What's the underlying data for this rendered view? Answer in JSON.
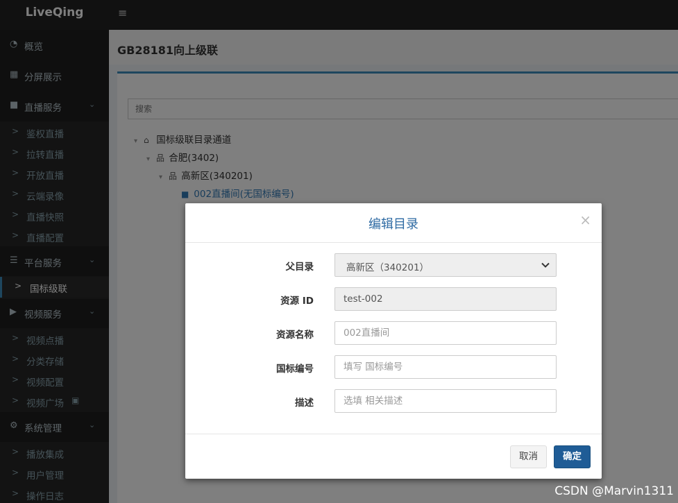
{
  "app": {
    "logo": "LiveQing",
    "menu_icon": "hamburger-icon"
  },
  "sidebar": {
    "items": [
      {
        "icon": "dashboard-icon",
        "glyph": "◔",
        "label": "概览"
      },
      {
        "icon": "grid-icon",
        "glyph": "▦",
        "label": "分屏展示"
      },
      {
        "icon": "video-camera-icon",
        "glyph": "■",
        "label": "直播服务",
        "chevron": "⌄"
      }
    ],
    "live_sub": [
      "鉴权直播",
      "拉转直播",
      "开放直播",
      "云端录像",
      "直播快照",
      "直播配置"
    ],
    "platform": {
      "icon": "server-icon",
      "glyph": "☰",
      "label": "平台服务",
      "chevron": "⌄"
    },
    "platform_sub": [
      "国标级联"
    ],
    "video": {
      "icon": "youtube-icon",
      "glyph": "▶",
      "label": "视频服务",
      "chevron": "⌄"
    },
    "video_sub": [
      "视频点播",
      "分类存储",
      "视频配置",
      "视频广场"
    ],
    "system": {
      "icon": "gear-icon",
      "glyph": "⚙",
      "label": "系统管理",
      "chevron": "⌄"
    },
    "system_sub": [
      "播放集成",
      "用户管理",
      "操作日志"
    ],
    "sub_arrow": ">"
  },
  "page": {
    "title": "GB28181向上级联",
    "search_placeholder": "搜索"
  },
  "tree": [
    {
      "caret": "▾",
      "icon": "home-icon",
      "glyph": "⌂",
      "label": "国标级联目录通道"
    },
    {
      "caret": "▾",
      "icon": "sitemap-icon",
      "glyph": "品",
      "label": "合肥(3402)"
    },
    {
      "caret": "▾",
      "icon": "sitemap-icon",
      "glyph": "品",
      "label": "高新区(340201)"
    },
    {
      "caret": "",
      "icon": "video-camera-icon",
      "glyph": "■",
      "label": "002直播间(无国标编号)"
    }
  ],
  "modal": {
    "title": "编辑目录",
    "close": "×",
    "fields": {
      "parent": {
        "label": "父目录",
        "value": "高新区（340201）"
      },
      "resource_id": {
        "label": "资源 ID",
        "value": "test-002"
      },
      "resource_name": {
        "label": "资源名称",
        "value": "002直播间"
      },
      "gb_code": {
        "label": "国标编号",
        "placeholder": "填写 国标编号"
      },
      "description": {
        "label": "描述",
        "placeholder": "选填 相关描述"
      }
    },
    "cancel_label": "取消",
    "ok_label": "确定"
  },
  "watermark": "CSDN @Marvin1311"
}
